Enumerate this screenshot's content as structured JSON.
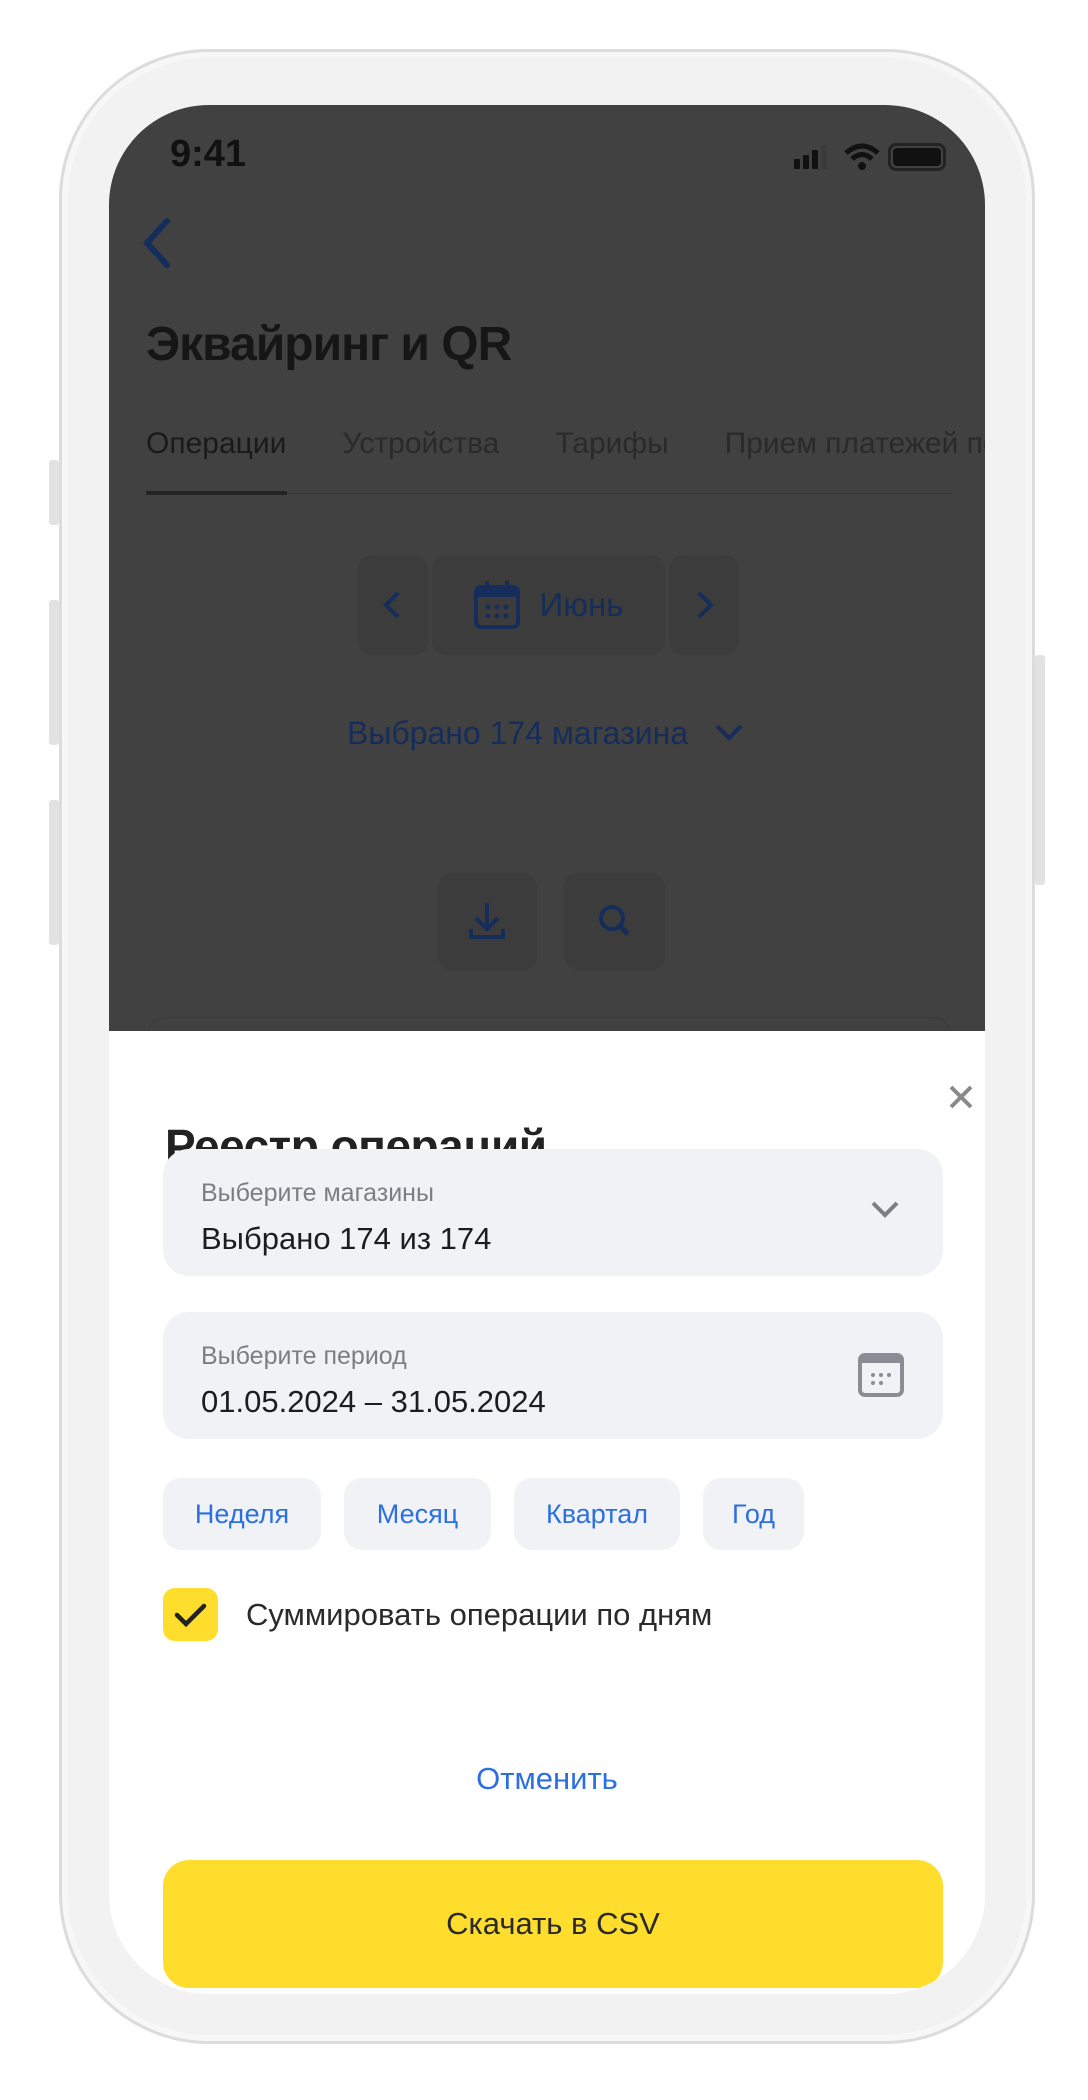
{
  "status_bar": {
    "time": "9:41"
  },
  "background": {
    "title": "Эквайринг и QR",
    "tabs": [
      "Операции",
      "Устройства",
      "Тарифы",
      "Прием платежей по"
    ],
    "month": "Июнь",
    "stores_selected": "Выбрано 174 магазина"
  },
  "sheet": {
    "title": "Реестр операций",
    "stores_field": {
      "label": "Выберите магазины",
      "value": "Выбрано 174 из 174"
    },
    "period_field": {
      "label": "Выберите период",
      "value": "01.05.2024 – 31.05.2024"
    },
    "chips": [
      "Неделя",
      "Месяц",
      "Квартал",
      "Год"
    ],
    "checkbox": {
      "label": "Суммировать операции по дням",
      "checked": true
    },
    "cancel": "Отменить",
    "download": "Скачать в CSV"
  },
  "colors": {
    "accent_yellow": "#ffdd2d",
    "link_blue": "#2c6fe0",
    "overlay": "#414141"
  }
}
